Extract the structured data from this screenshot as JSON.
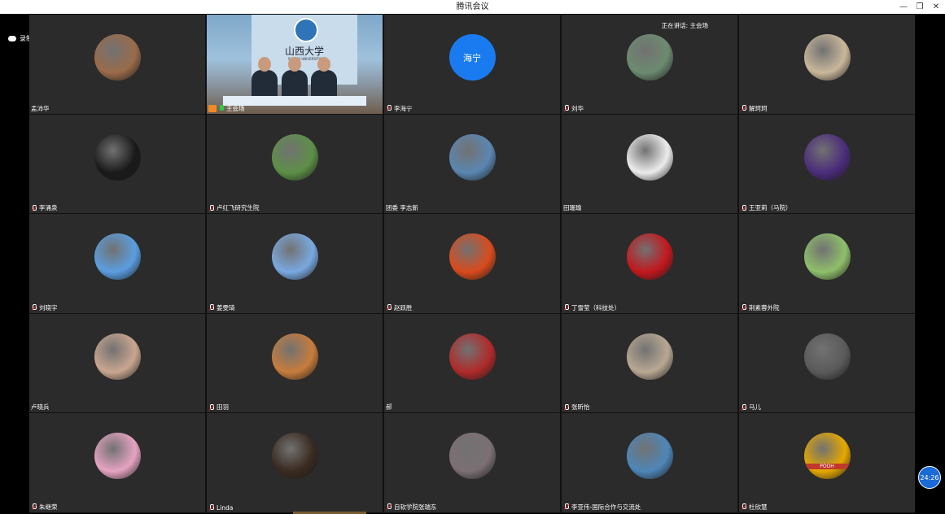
{
  "window": {
    "title": "腾讯会议",
    "controls": [
      "—",
      "❐",
      "✕"
    ]
  },
  "recording": {
    "label": "录制中"
  },
  "speaking": {
    "label": "正在讲话: 主会场"
  },
  "timer": {
    "label": "24:26"
  },
  "participants": [
    {
      "name": "孟沛华",
      "mic": false,
      "avatar": "photo"
    },
    {
      "name": "主会场",
      "mic": true,
      "host": true,
      "video": true,
      "banner_text": "山西大学",
      "banner_sub": "SHANXI UNIVERSITY"
    },
    {
      "name": "李海宁",
      "mic": true,
      "avatar": "text",
      "avatar_text": "海宁"
    },
    {
      "name": "刘华",
      "mic": true,
      "avatar": "photo"
    },
    {
      "name": "解珂珂",
      "mic": true,
      "avatar": "photo"
    },
    {
      "name": "李涌泉",
      "mic": true,
      "avatar": "photo"
    },
    {
      "name": "卢红飞研究生院",
      "mic": true,
      "avatar": "photo"
    },
    {
      "name": "团委 李志新",
      "mic": false,
      "avatar": "photo"
    },
    {
      "name": "田珊瑜",
      "mic": false,
      "avatar": "photo"
    },
    {
      "name": "王亚莉（马院）",
      "mic": true,
      "avatar": "photo"
    },
    {
      "name": "刘晓宇",
      "mic": true,
      "avatar": "photo"
    },
    {
      "name": "姜雯琦",
      "mic": true,
      "avatar": "photo"
    },
    {
      "name": "赵跃胜",
      "mic": true,
      "avatar": "photo"
    },
    {
      "name": "丁雪莹（科技处）",
      "mic": true,
      "avatar": "photo"
    },
    {
      "name": "荆素蓉外院",
      "mic": true,
      "avatar": "photo"
    },
    {
      "name": "卢晓兵",
      "mic": false,
      "avatar": "photo"
    },
    {
      "name": "田羽",
      "mic": true,
      "avatar": "photo"
    },
    {
      "name": "郝",
      "mic": false,
      "avatar": "photo"
    },
    {
      "name": "张昕怡",
      "mic": true,
      "avatar": "photo"
    },
    {
      "name": "马儿",
      "mic": true,
      "avatar": "photo"
    },
    {
      "name": "朱继荣",
      "mic": true,
      "avatar": "photo"
    },
    {
      "name": "Linda",
      "mic": true,
      "avatar": "photo"
    },
    {
      "name": "自软学院张瑞东",
      "mic": true,
      "avatar": "photo"
    },
    {
      "name": "李亚伟-国际合作与交流处",
      "mic": true,
      "avatar": "photo"
    },
    {
      "name": "杜欣慧",
      "mic": true,
      "avatar": "photo",
      "avatar_text": "POOH"
    }
  ],
  "avatar_colors": [
    "#9a6b4a",
    "#2f74b6",
    "#1a7bf0",
    "#6c8b70",
    "#c9b79a",
    "#1a1a1a",
    "#5d8f47",
    "#5b86b1",
    "#ececec",
    "#4b2c7a",
    "#5a9ee0",
    "#79a9e0",
    "#d94b1d",
    "#c2181e",
    "#8fbf6a",
    "#c9a690",
    "#c77c3c",
    "#b02a2a",
    "#b8a892",
    "#5a5a5a",
    "#e6a3c2",
    "#3a2a20",
    "#7b6f73",
    "#4e86b8",
    "#e5a800"
  ]
}
